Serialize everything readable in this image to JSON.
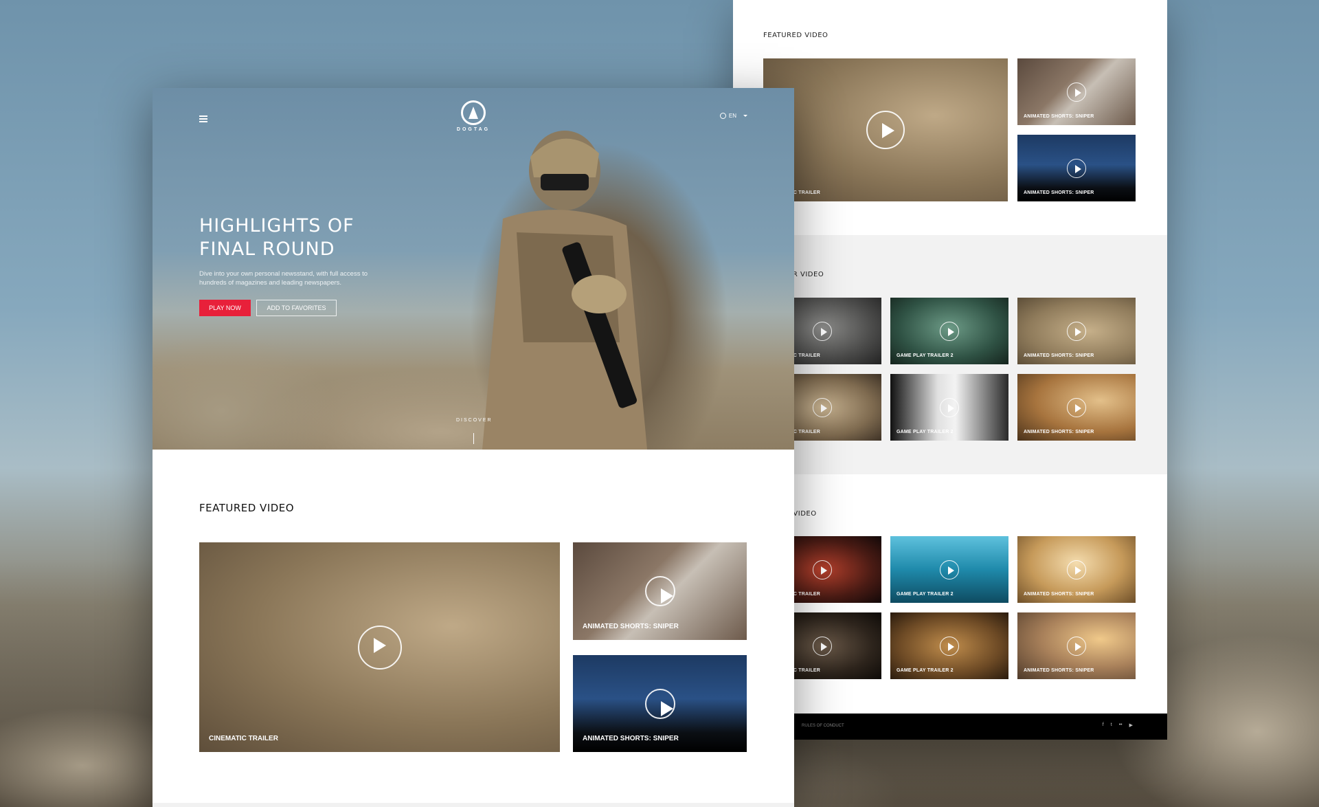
{
  "front": {
    "logo_text": "DOGTAG",
    "lang_label": "EN",
    "hero": {
      "title": "HIGHLIGHTS OF FINAL ROUND",
      "description": "Dive into your own personal newsstand, with full access to hundreds of magazines and leading newspapers.",
      "play_label": "PLAY NOW",
      "favorite_label": "ADD TO FAVORITES",
      "discover_label": "DISCOVER"
    },
    "featured_title": "FEATURED VIDEO",
    "featured": [
      {
        "caption": "CINEMATIC TRAILER"
      },
      {
        "caption": "ANIMATED SHORTS: SNIPER"
      },
      {
        "caption": "ANIMATED SHORTS: SNIPER"
      }
    ]
  },
  "back": {
    "featured_title": "FEATURED VIDEO",
    "featured": [
      {
        "caption": "CINEMATIC TRAILER"
      },
      {
        "caption": "ANIMATED SHORTS: SNIPER"
      },
      {
        "caption": "ANIMATED SHORTS: SNIPER"
      }
    ],
    "section2_title": "POPULAR VIDEO",
    "section2": [
      {
        "caption": "CINEMATIC TRAILER"
      },
      {
        "caption": "GAME PLAY TRAILER 2"
      },
      {
        "caption": "ANIMATED SHORTS: SNIPER"
      },
      {
        "caption": "CINEMATIC TRAILER"
      },
      {
        "caption": "GAME PLAY TRAILER 2"
      },
      {
        "caption": "ANIMATED SHORTS: SNIPER"
      }
    ],
    "section3_title": "LATEST VIDEO",
    "section3": [
      {
        "caption": "CINEMATIC TRAILER"
      },
      {
        "caption": "GAME PLAY TRAILER 2"
      },
      {
        "caption": "ANIMATED SHORTS: SNIPER"
      },
      {
        "caption": "CINEMATIC TRAILER"
      },
      {
        "caption": "GAME PLAY TRAILER 2"
      },
      {
        "caption": "ANIMATED SHORTS: SNIPER"
      }
    ],
    "footer": {
      "rules_label": "RULES OF CONDUCT",
      "social": [
        "f",
        "t",
        "••",
        "▶"
      ]
    }
  },
  "colors": {
    "accent": "#e8203a",
    "footer_bg": "#000000",
    "band_bg": "#f2f2f2"
  }
}
